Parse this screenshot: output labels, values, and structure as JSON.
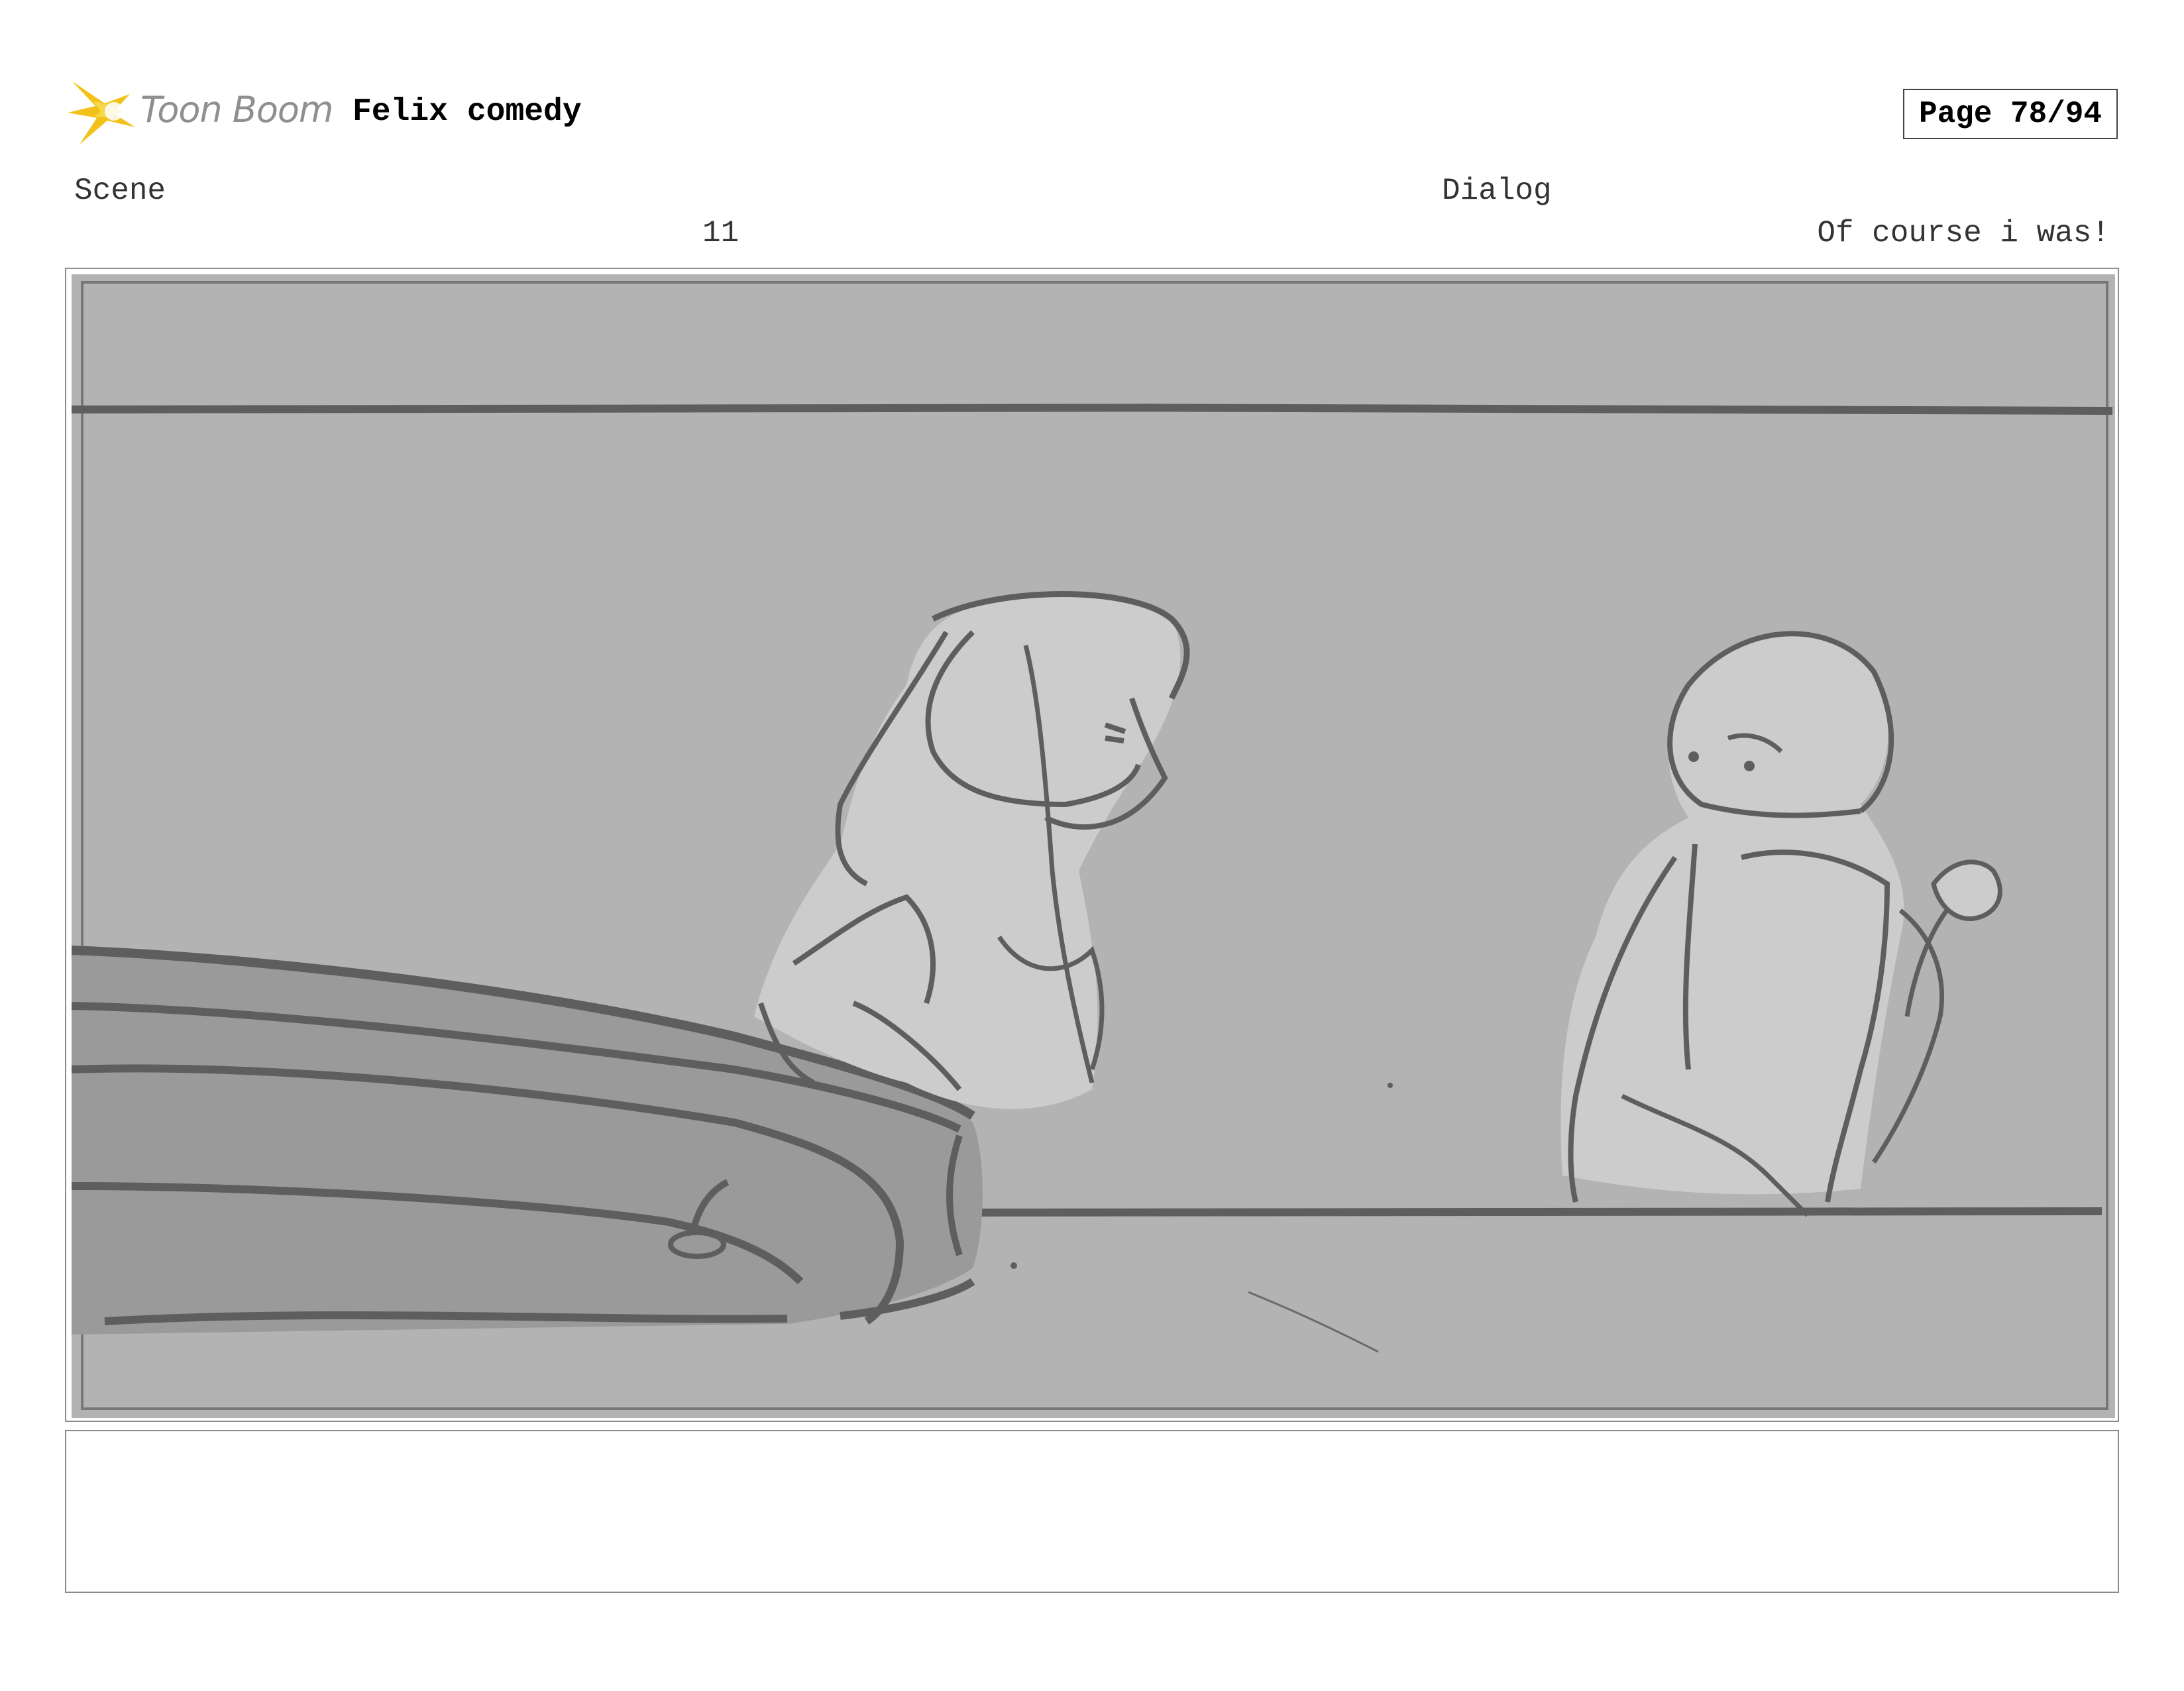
{
  "header": {
    "brand": "Toon Boom",
    "logo_icon": "toon-boom-starburst-icon",
    "project_title": "Felix comedy",
    "page_label": "Page 78/94"
  },
  "scene": {
    "label": "Scene",
    "number": "11"
  },
  "dialog": {
    "label": "Dialog",
    "text": "Of course i was!"
  },
  "panel": {
    "image_name": "storyboard-sketch",
    "notes": ""
  },
  "colors": {
    "logo_yellow": "#f2c21b",
    "logo_text": "#8f8f8f",
    "sketch_background": "#b3b3b3",
    "sketch_line": "#5e5e5e",
    "sketch_fill_light": "#cccccc",
    "sketch_fill_dark": "#9a9a9a"
  }
}
